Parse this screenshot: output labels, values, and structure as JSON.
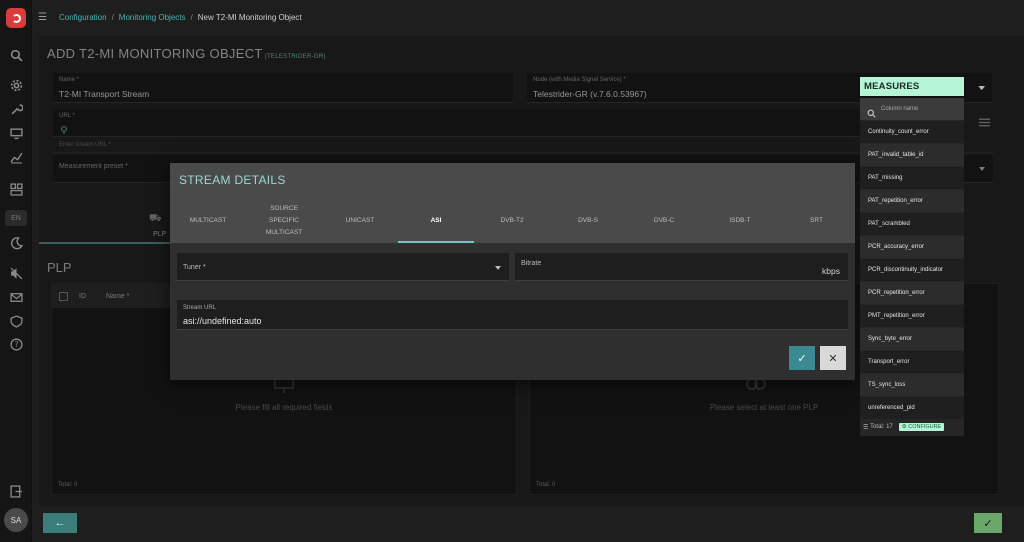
{
  "breadcrumb": {
    "items": [
      "Configuration",
      "Monitoring Objects"
    ],
    "current": "New T2-MI Monitoring Object"
  },
  "page": {
    "title": "ADD T2-MI MONITORING OBJECT",
    "subtitle": "(TELESTRIDER-GR)"
  },
  "form": {
    "name_label": "Name *",
    "name_value": "T2-MI Transport Stream",
    "node_label": "Node (with Media Signal Service) *",
    "node_value": "Telestrider-GR (v.7.6.0.53967)",
    "url_label": "URL *",
    "stream_url_placeholder": "Enter stream URL *",
    "preset_label": "Measurement preset *"
  },
  "plp": {
    "title": "PLP",
    "tab_label": "PLP",
    "table_cols": [
      "ID",
      "Name *"
    ],
    "left_empty": "Please fill all required fields",
    "right_empty": "Please select at least one PLP",
    "left_total": "Total: 0",
    "right_total": "Total: 0"
  },
  "dialog": {
    "title": "STREAM DETAILS",
    "tabs": [
      {
        "label": "MULTICAST"
      },
      {
        "label": "SOURCE SPECIFIC MULTICAST"
      },
      {
        "label": "UNICAST"
      },
      {
        "label": "ASI"
      },
      {
        "label": "DVB-T2"
      },
      {
        "label": "DVB-S"
      },
      {
        "label": "DVB-C"
      },
      {
        "label": "ISDB-T"
      },
      {
        "label": "SRT"
      }
    ],
    "tuner_label": "Tuner *",
    "bitrate_label": "Bitrate",
    "bitrate_unit": "kbps",
    "stream_url_label": "Stream URL",
    "stream_url_value": "asi://undefined:auto"
  },
  "measures": {
    "header": "MEASURES",
    "search_placeholder": "Column name",
    "items": [
      "Continuity_count_error",
      "PAT_invalid_table_id",
      "PAT_missing",
      "PAT_repetition_error",
      "PAT_scrambled",
      "PCR_accuracy_error",
      "PCR_discontinuity_indicator",
      "PCR_repetition_error",
      "PMT_repetition_error",
      "Sync_byte_error",
      "Transport_error",
      "TS_sync_loss",
      "unreferenced_pid"
    ],
    "total": "Total: 17",
    "configure_label": "CONFIGURE"
  },
  "sidebar": {
    "lang": "EN",
    "avatar": "SA"
  },
  "colors": {
    "accent": "#4db3ae",
    "measures_header": "#b5f5d6",
    "logo": "#d93c3c"
  }
}
